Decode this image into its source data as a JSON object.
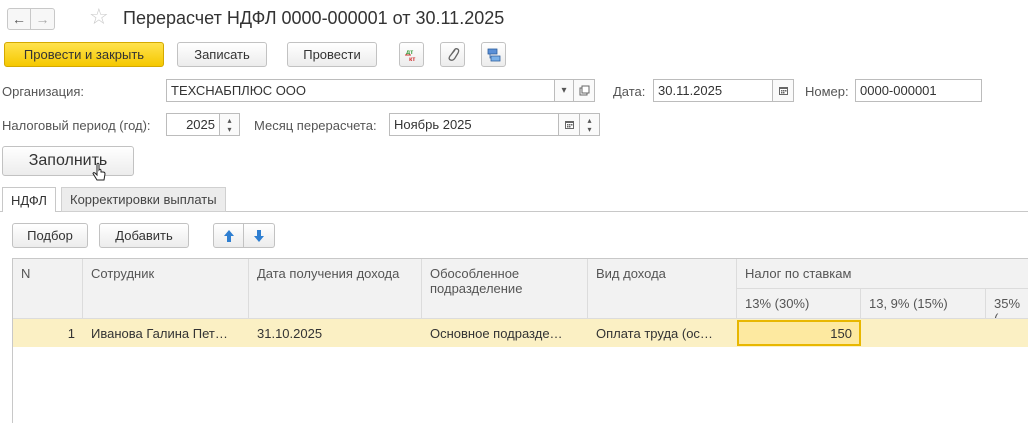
{
  "header": {
    "back_label": "←",
    "forward_label": "→",
    "favorite_icon": "star-icon",
    "title": "Перерасчет НДФЛ 0000-000001 от 30.11.2025"
  },
  "toolbar": {
    "post_and_close": "Провести и закрыть",
    "save": "Записать",
    "post": "Провести",
    "dt_kt_icon": "dt-kt-icon",
    "attachment_icon": "paperclip-icon",
    "structure_icon": "document-structure-icon"
  },
  "form": {
    "organization_label": "Организация:",
    "organization_value": "ТЕХСНАБПЛЮС ООО",
    "date_label": "Дата:",
    "date_value": "30.11.2025",
    "number_label": "Номер:",
    "number_value": "0000-000001",
    "tax_period_label": "Налоговый период (год):",
    "tax_period_value": "2025",
    "recalc_month_label": "Месяц перерасчета:",
    "recalc_month_value": "Ноябрь 2025",
    "fill_button": "Заполнить"
  },
  "tabs": [
    {
      "label": "НДФЛ",
      "active": true
    },
    {
      "label": "Корректировки выплаты",
      "active": false
    }
  ],
  "table_toolbar": {
    "pick": "Подбор",
    "add": "Добавить",
    "move_up_icon": "arrow-up-icon",
    "move_down_icon": "arrow-down-icon"
  },
  "table": {
    "columns": {
      "n": "N",
      "employee": "Сотрудник",
      "income_date": "Дата получения дохода",
      "division": "Обособленное подразделение",
      "income_type": "Вид дохода",
      "tax_by_rates": "Налог по ставкам",
      "rate_13": "13% (30%)",
      "rate_13_9": "13, 9% (15%)",
      "rate_35": "35% ("
    },
    "rows": [
      {
        "n": "1",
        "employee": "Иванова Галина Пет…",
        "income_date": "31.10.2025",
        "division": "Основное подразде…",
        "income_type": "Оплата труда (ос…",
        "rate_13": "150",
        "rate_13_9": "",
        "rate_35": ""
      }
    ]
  },
  "colors": {
    "primary_button": "#f5c800",
    "selected_row": "#fbf0c4",
    "selected_cell_border": "#e8b700",
    "arrow_blue": "#2f7fd1"
  }
}
